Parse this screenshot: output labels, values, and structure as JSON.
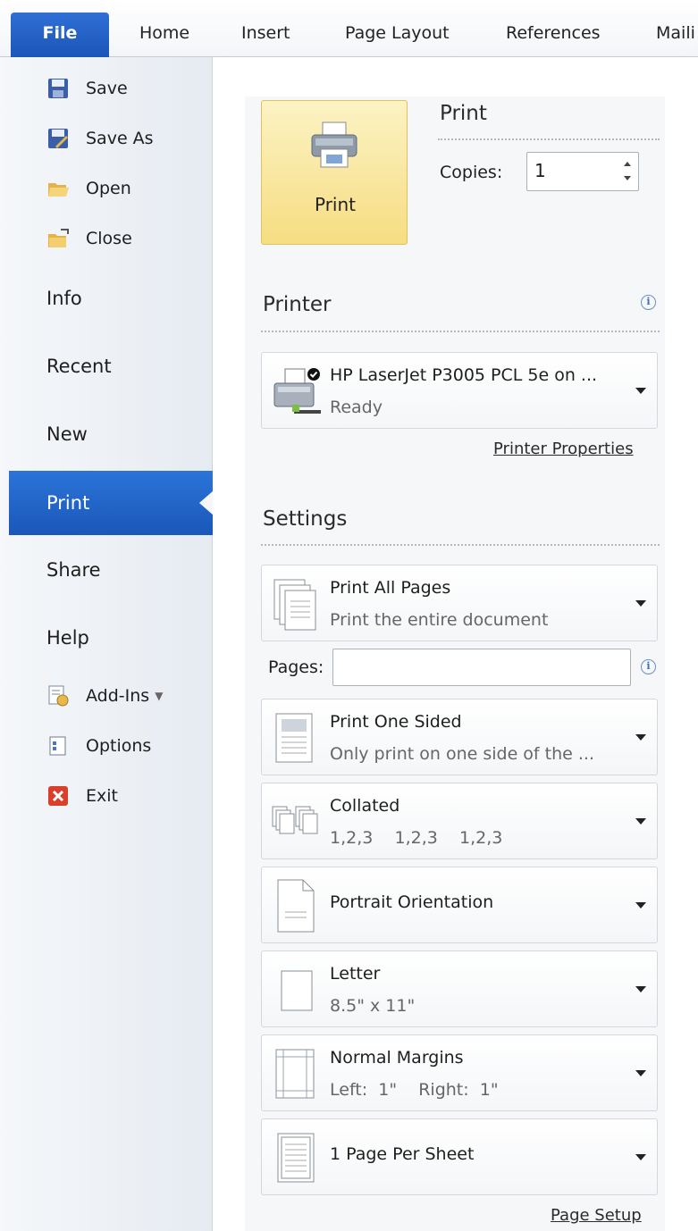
{
  "ribbon": {
    "tabs": [
      "File",
      "Home",
      "Insert",
      "Page Layout",
      "References",
      "Maili"
    ]
  },
  "nav": {
    "save": "Save",
    "save_as": "Save As",
    "open": "Open",
    "close": "Close",
    "info": "Info",
    "recent": "Recent",
    "new": "New",
    "print": "Print",
    "share": "Share",
    "help": "Help",
    "add_ins": "Add-Ins",
    "options": "Options",
    "exit": "Exit"
  },
  "print": {
    "button_label": "Print",
    "heading": "Print",
    "copies_label": "Copies:",
    "copies_value": "1"
  },
  "printer": {
    "heading": "Printer",
    "name": "HP LaserJet P3005 PCL 5e on ...",
    "status": "Ready",
    "properties_link": "Printer Properties"
  },
  "settings": {
    "heading": "Settings",
    "pages_label": "Pages:",
    "pages_value": "",
    "page_setup_link": "Page Setup",
    "items": [
      {
        "title": "Print All Pages",
        "subtitle": "Print the entire document"
      },
      {
        "title": "Print One Sided",
        "subtitle": "Only print on one side of the ..."
      },
      {
        "title": "Collated",
        "subtitle": "1,2,3    1,2,3    1,2,3"
      },
      {
        "title": "Portrait Orientation",
        "subtitle": ""
      },
      {
        "title": "Letter",
        "subtitle": "8.5\" x 11\""
      },
      {
        "title": "Normal Margins",
        "subtitle": "Left:  1\"    Right:  1\""
      },
      {
        "title": "1 Page Per Sheet",
        "subtitle": ""
      }
    ]
  },
  "colors": {
    "accent": "#1b56b8",
    "print_button": "#f6dd82"
  }
}
